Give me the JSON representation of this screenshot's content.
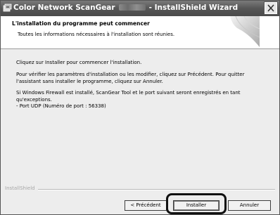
{
  "window": {
    "title_prefix": "Color Network ScanGear",
    "title_suffix": "- InstallShield Wizard",
    "close_label": "X"
  },
  "header": {
    "title": "L'installation du programme peut commencer",
    "subtitle": "Toutes les informations nécessaires à l'installation sont réunies."
  },
  "body": {
    "paragraphs": [
      [
        "Cliquez sur Installer pour commencer l'installation."
      ],
      [
        "Pour vérifier les paramètres d'installation ou les modifier, cliquez sur Précédent. Pour quitter",
        "l'assistant sans installer le programme, cliquez sur Annuler."
      ],
      [
        "Si Windows Firewall est installé, ScanGear Tool et le port suivant seront enregistrés en tant",
        "qu'exceptions.",
        "- Port UDP (Numéro de port : 56338)"
      ]
    ]
  },
  "footer": {
    "brand": "InstallShield",
    "buttons": {
      "back": "< Précédent",
      "install": "Installer",
      "cancel": "Annuler"
    }
  },
  "colors": {
    "titlebar": "#565656",
    "dialog_bg": "#ededed",
    "highlight": "#101010"
  }
}
